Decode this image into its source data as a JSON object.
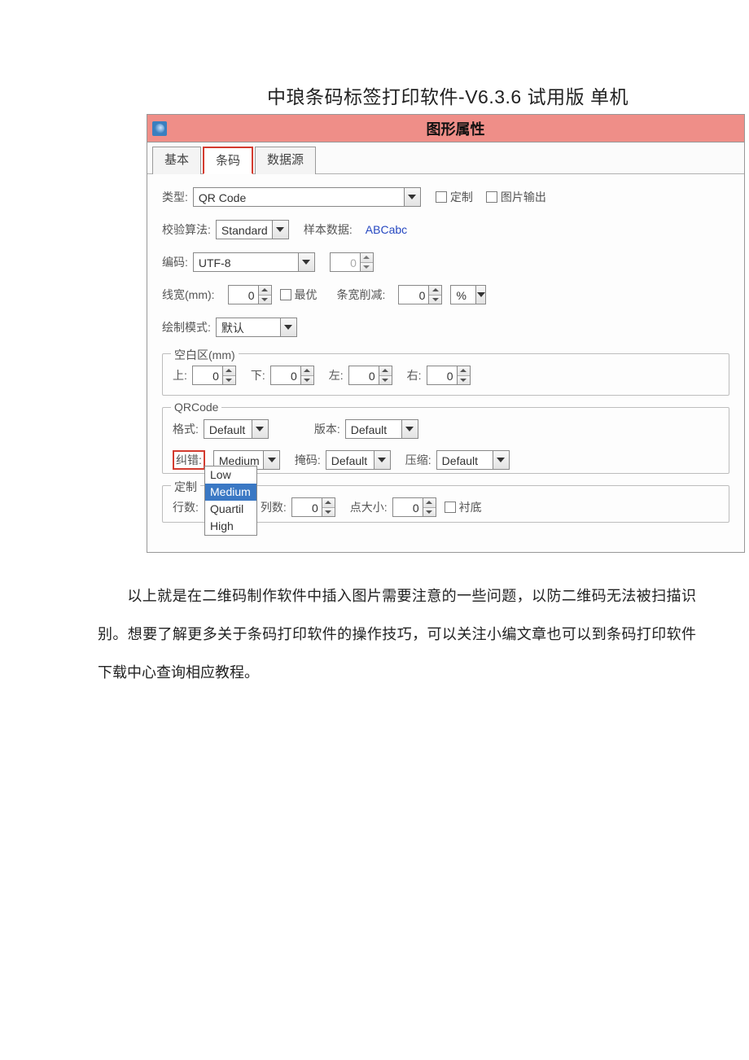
{
  "app": {
    "title": "中琅条码标签打印软件-V6.3.6 试用版 单机"
  },
  "dialog": {
    "title": "图形属性"
  },
  "tabs": {
    "basic": "基本",
    "barcode": "条码",
    "datasource": "数据源"
  },
  "labels": {
    "type": "类型:",
    "custom": "定制",
    "imgOutput": "图片输出",
    "check": "校验算法:",
    "sample": "样本数据:",
    "encode": "编码:",
    "lineWidth": "线宽(mm):",
    "best": "最优",
    "reduce": "条宽削减:",
    "drawMode": "绘制模式:",
    "margin": "空白区(mm)",
    "top": "上:",
    "bottom": "下:",
    "left": "左:",
    "right": "右:",
    "qrcode": "QRCode",
    "format": "格式:",
    "version": "版本:",
    "ecc": "纠错:",
    "mask": "掩码:",
    "compress": "压缩:",
    "customGroup": "定制",
    "rows": "行数:",
    "cols": "列数:",
    "dotSize": "点大小:",
    "baseFill": "衬底"
  },
  "values": {
    "type": "QR Code",
    "check": "Standard",
    "sample": "ABCabc",
    "encode": "UTF-8",
    "encodeExtra": "0",
    "lineWidth": "0",
    "reduce": "0",
    "reduceUnit": "%",
    "drawMode": "默认",
    "marginTop": "0",
    "marginBottom": "0",
    "marginLeft": "0",
    "marginRight": "0",
    "format": "Default",
    "version": "Default",
    "ecc": "Medium",
    "mask": "Default",
    "compress": "Default",
    "rows": "",
    "cols": "0",
    "dotSize": "0"
  },
  "ecc_options": {
    "low": "Low",
    "medium": "Medium",
    "quartil": "Quartil",
    "high": "High"
  },
  "paragraph": "以上就是在二维码制作软件中插入图片需要注意的一些问题，以防二维码无法被扫描识别。想要了解更多关于条码打印软件的操作技巧，可以关注小编文章也可以到条码打印软件下载中心查询相应教程。"
}
